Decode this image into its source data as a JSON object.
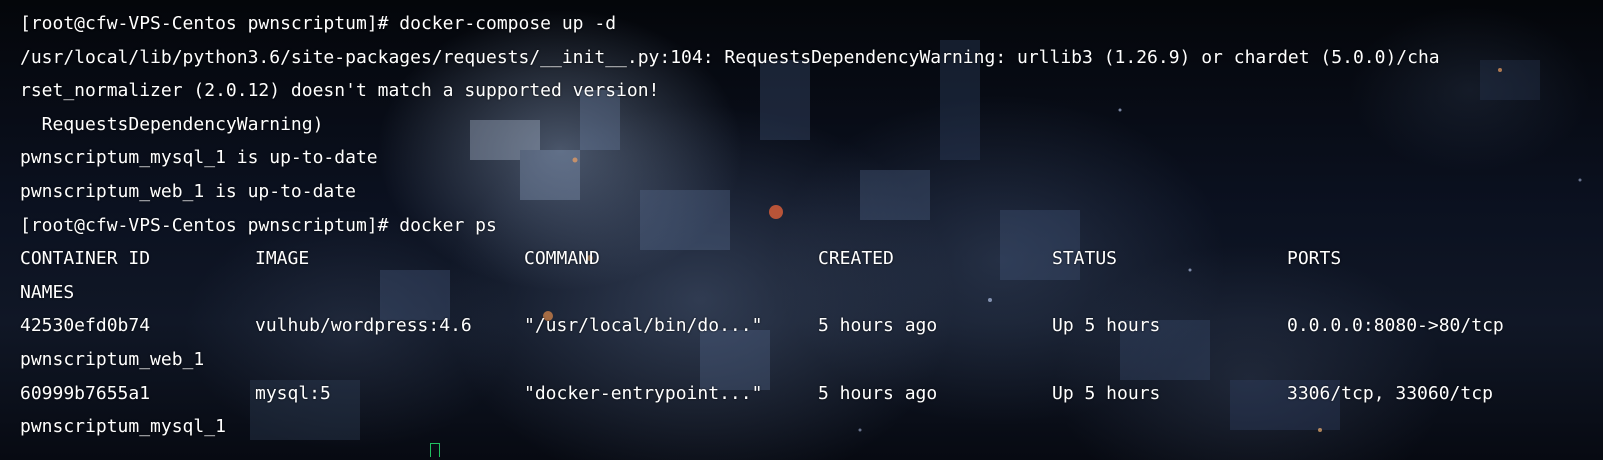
{
  "terminal": {
    "lines": [
      "[root@cfw-VPS-Centos pwnscriptum]# docker-compose up -d",
      "/usr/local/lib/python3.6/site-packages/requests/__init__.py:104: RequestsDependencyWarning: urllib3 (1.26.9) or chardet (5.0.0)/cha",
      "rset_normalizer (2.0.12) doesn't match a supported version!",
      "  RequestsDependencyWarning)",
      "pwnscriptum_mysql_1 is up-to-date",
      "pwnscriptum_web_1 is up-to-date",
      "[root@cfw-VPS-Centos pwnscriptum]# docker ps"
    ],
    "ps_table": {
      "headers": [
        "CONTAINER ID",
        "IMAGE",
        "COMMAND",
        "CREATED",
        "STATUS",
        "PORTS"
      ],
      "names_header": "NAMES",
      "rows": [
        {
          "container_id": "42530efd0b74",
          "image": "vulhub/wordpress:4.6",
          "command": "\"/usr/local/bin/do...\"",
          "created": "5 hours ago",
          "status": "Up 5 hours",
          "ports": "0.0.0.0:8080->80/tcp",
          "name": "pwnscriptum_web_1"
        },
        {
          "container_id": "60999b7655a1",
          "image": "mysql:5",
          "command": "\"docker-entrypoint...\"",
          "created": "5 hours ago",
          "status": "Up 5 hours",
          "ports": "3306/tcp, 33060/tcp",
          "name": "pwnscriptum_mysql_1"
        }
      ]
    }
  },
  "colors": {
    "text": "#ffffff",
    "cursor": "#20c060"
  }
}
